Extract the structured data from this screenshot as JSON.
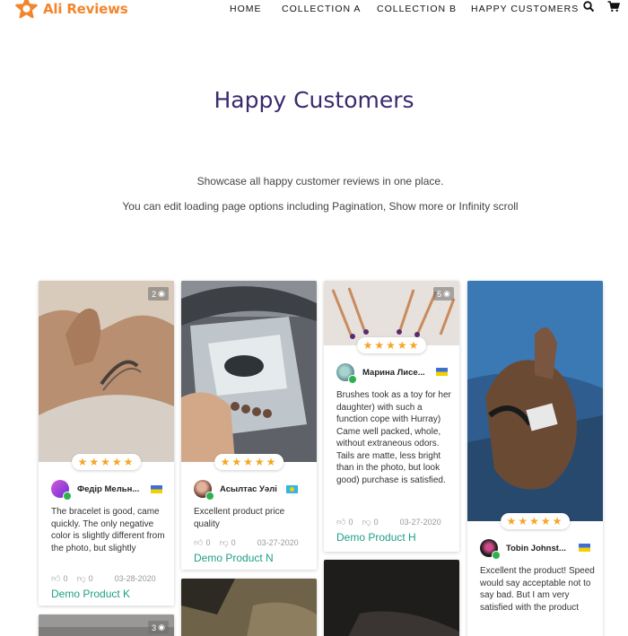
{
  "brand": {
    "name": "Ali Reviews",
    "color": "#f3852d"
  },
  "nav": {
    "items": [
      "HOME",
      "COLLECTION A",
      "COLLECTION B",
      "HAPPY CUSTOMERS"
    ],
    "icons": [
      "search-icon",
      "cart-icon"
    ]
  },
  "page": {
    "title": "Happy Customers",
    "desc1": "Showcase all happy customer reviews in one place.",
    "desc2": "You can edit loading page options including Pagination, Show more or Infinity scroll"
  },
  "colors": {
    "accent_text": "#1f9f86",
    "title": "#3a2a6e",
    "star": "#f5a623",
    "verified": "#2bb24c"
  },
  "reviews": [
    {
      "photo_count": "2",
      "stars": "★★★★★",
      "rating": 5,
      "name": "Федір Мельн...",
      "flag": "ukraine-flag",
      "text": "The bracelet is good, came quickly. The only negative color is slightly different from the photo, but slightly",
      "likes": "0",
      "dislikes": "0",
      "date": "03-28-2020",
      "product": "Demo Product K"
    },
    {
      "photo_count": "",
      "stars": "★★★★★",
      "rating": 5,
      "name": "Асылтас Уәлі",
      "flag": "kazakhstan-flag",
      "text": "Excellent product price quality",
      "likes": "0",
      "dislikes": "0",
      "date": "03-27-2020",
      "product": "Demo Product N"
    },
    {
      "photo_count": "5",
      "stars": "★★★★★",
      "rating": 5,
      "name": "Марина Лисе...",
      "flag": "ukraine-flag",
      "text": "Brushes took as a toy for her daughter) with such a function cope with Hurray) Came well packed, whole, without extraneous odors. Tails are matte, less bright than in the photo, but look good) purchase is satisfied.",
      "likes": "0",
      "dislikes": "0",
      "date": "03-27-2020",
      "product": "Demo Product H"
    },
    {
      "photo_count": "",
      "stars": "★★★★★",
      "rating": 5,
      "name": "Tobin Johnst...",
      "flag": "ukraine-flag",
      "text": "Excellent the product! Speed would say acceptable not to say bad. But I am very satisfied with the product",
      "likes": "",
      "dislikes": "",
      "date": "",
      "product": ""
    }
  ],
  "bottom_row": [
    {
      "photo_count": "3"
    }
  ]
}
